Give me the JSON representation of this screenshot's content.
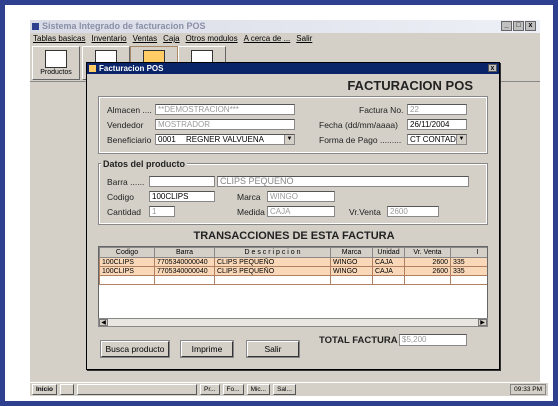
{
  "app": {
    "title": "Sistema Integrado de facturacion POS",
    "window_buttons": [
      "_",
      "□",
      "x"
    ]
  },
  "menu": [
    "Tablas basicas",
    "Inventario",
    "Ventas",
    "Caja",
    "Otros modulos",
    "A cerca de ...",
    "Salir"
  ],
  "toolbar": {
    "productos_label": "Productos"
  },
  "dialog": {
    "title": "Facturacion POS",
    "close": "x",
    "heading": "FACTURACION POS",
    "almacen_label": "Almacen ....",
    "almacen_value": "**DEMOSTRACION***",
    "vendedor_label": "Vendedor",
    "vendedor_value": "MOSTRADOR",
    "beneficiario_label": "Beneficiario",
    "beneficiario_code": "0001",
    "beneficiario_name": "REGNER VALVUENA",
    "factura_label": "Factura No.",
    "factura_value": "22",
    "fecha_label": "Fecha (dd/mm/aaaa)",
    "fecha_value": "26/11/2004",
    "forma_label": "Forma de Pago .........",
    "forma_value": "CT CONTADO",
    "producto_section": "Datos del producto",
    "barra_label": "Barra ......",
    "barra_value": "",
    "descripcion_value": "CLIPS PEQUEÑO",
    "codigo_label": "Codigo",
    "codigo_value": "100CLIPS",
    "marca_label": "Marca",
    "marca_value": "WINGO",
    "cantidad_label": "Cantidad",
    "cantidad_value": "1",
    "medida_label": "Medida",
    "medida_value": "CAJA",
    "vrventa_label": "Vr.Venta",
    "vrventa_value": "2600",
    "transacciones_title": "TRANSACCIONES DE ESTA FACTURA",
    "table": {
      "headers": [
        "Codigo",
        "Barra",
        "D e s c r i p c i o n",
        "Marca",
        "Unidad",
        "Vr. Venta",
        "I"
      ],
      "rows": [
        [
          "100CLIPS",
          "7705340000040",
          "CLIPS PEQUEÑO",
          "WINGO",
          "CAJA",
          "2600",
          "335"
        ],
        [
          "100CLIPS",
          "7705340000040",
          "CLIPS PEQUEÑO",
          "WINGO",
          "CAJA",
          "2600",
          "335"
        ]
      ]
    },
    "busca_button": "Busca producto",
    "imprime_button": "Imprime",
    "salir_button": "Salir",
    "total_label": "TOTAL FACTURA",
    "total_value": "$5,200"
  },
  "taskbar": {
    "start": "Inicio",
    "tasks": [
      "",
      "",
      "Pr...",
      "Fo...",
      "Mic...",
      "Sal..."
    ],
    "clock": "09:33 PM"
  }
}
